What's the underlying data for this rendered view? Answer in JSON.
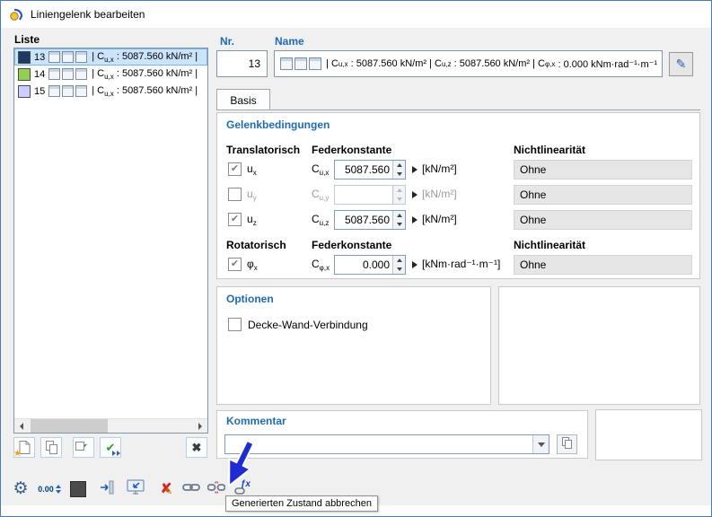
{
  "window": {
    "title": "Liniengelenk bearbeiten"
  },
  "list": {
    "header": "Liste",
    "item_label": {
      "p1": "| C",
      "sub1": "u,x",
      "p2": " : 5087.560 kN/m² |"
    },
    "items": [
      {
        "num": "13",
        "color": "#1f3864"
      },
      {
        "num": "14",
        "color": "#92d050"
      },
      {
        "num": "15",
        "color": "#ccccff"
      }
    ]
  },
  "header": {
    "nr_label": "Nr.",
    "nr_value": "13",
    "name_label": "Name"
  },
  "name_field": {
    "p1": "| C",
    "s1": "u,x",
    "p2": " : 5087.560 kN/m² | C",
    "s2": "u,z",
    "p3": " : 5087.560 kN/m² | C",
    "s3": "φ,x",
    "p4": " : 0.000 kNm·rad⁻¹·m⁻¹"
  },
  "form": {
    "tab": "Basis",
    "section": "Gelenkbedingungen",
    "translational": "Translatorisch",
    "rotational": "Rotatorisch",
    "spring_constant": "Federkonstante",
    "nonlinearity": "Nichtlinearität",
    "rows": [
      {
        "check": "✔",
        "dof": "u",
        "dof_sub": "x",
        "coef": "C",
        "coef_sub": "u,x",
        "value": "5087.560",
        "unit": "[kN/m²]",
        "nonlin": "Ohne"
      },
      {
        "check": "",
        "dof": "u",
        "dof_sub": "y",
        "coef": "C",
        "coef_sub": "u,y",
        "value": "",
        "unit": "[kN/m²]",
        "nonlin": "Ohne"
      },
      {
        "check": "✔",
        "dof": "u",
        "dof_sub": "z",
        "coef": "C",
        "coef_sub": "u,z",
        "value": "5087.560",
        "unit": "[kN/m²]",
        "nonlin": "Ohne"
      },
      {
        "check": "✔",
        "dof": "φ",
        "dof_sub": "x",
        "coef": "C",
        "coef_sub": "φ,x",
        "value": "0.000",
        "unit": "[kNm·rad⁻¹·m⁻¹]",
        "nonlin": "Ohne"
      }
    ]
  },
  "options": {
    "section": "Optionen",
    "label": "Decke-Wand-Verbindung",
    "check": ""
  },
  "comment": {
    "section": "Kommentar",
    "value": ""
  },
  "toolbar": {
    "decimal_label": "0.00"
  },
  "tooltip": {
    "text": "Generierten Zustand abbrechen"
  },
  "icons": {
    "star": "★",
    "check": "✔",
    "delete_x": "✖",
    "red_x": "✘",
    "pencil": "✎",
    "gear": "⚙",
    "fx": "ƒx",
    "names": {
      "dialog": "hinge-icon",
      "list_new": "new-item-icon",
      "list_copy": "copy-icon",
      "list_select": "green-check-icon",
      "list_apply": "green-check-arrows-icon",
      "list_delete": "x-icon",
      "name_edit": "pencil-icon",
      "comment_copy": "copy-icon",
      "tb1": "gear-icon",
      "tb2": "decimal-places-icon",
      "tb3": "color-swatch-icon",
      "tb4": "assign-arrow-icon",
      "tb5": "monitor-arrow-icon",
      "tb6": "red-x-pencil-icon",
      "tb7": "chain-link-icon",
      "tb8": "broken-chain-icon",
      "tb9": "chain-function-icon",
      "annotation": "blue-arrow-annotation"
    }
  }
}
